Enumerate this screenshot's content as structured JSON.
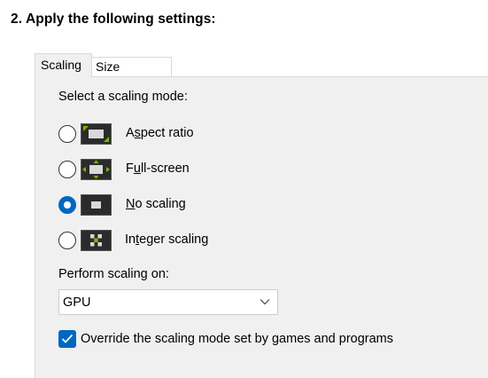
{
  "step": {
    "title": "2. Apply the following settings:"
  },
  "tabs": [
    {
      "label": "Scaling",
      "active": true
    },
    {
      "label": "Size",
      "active": false
    }
  ],
  "scaling_mode": {
    "prompt": "Select a scaling mode:",
    "options": [
      {
        "label": "Aspect ratio",
        "mnemonic": "s",
        "selected": false,
        "icon": "aspect-ratio-icon"
      },
      {
        "label": "Full-screen",
        "mnemonic": "u",
        "selected": false,
        "icon": "full-screen-icon"
      },
      {
        "label": "No scaling",
        "mnemonic": "N",
        "selected": true,
        "icon": "no-scaling-icon"
      },
      {
        "label": "Integer scaling",
        "mnemonic": "t",
        "selected": false,
        "icon": "integer-scaling-icon"
      }
    ]
  },
  "perform_scaling": {
    "label": "Perform scaling on:",
    "selected_value": "GPU"
  },
  "override": {
    "label": "Override the scaling mode set by games and programs",
    "checked": true
  },
  "colors": {
    "accent": "#0067c0",
    "panel": "#f0f0f0",
    "nvidia_green": "#76b900"
  }
}
